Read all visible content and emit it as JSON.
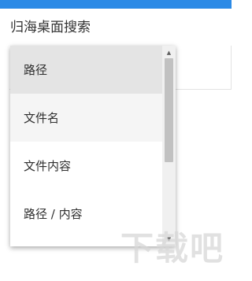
{
  "header": {
    "accent_color": "#2b8ae6",
    "title": "归海桌面搜索"
  },
  "search_mode_dropdown": {
    "options": [
      {
        "label": "路径",
        "state": "selected"
      },
      {
        "label": "文件名",
        "state": "hovered"
      },
      {
        "label": "文件内容",
        "state": "normal"
      },
      {
        "label": "路径 / 内容",
        "state": "normal"
      }
    ],
    "scrollbar": {
      "up_icon": "triangle-up-icon",
      "down_icon": "triangle-down-icon"
    }
  },
  "watermark": {
    "text": "下载吧"
  }
}
